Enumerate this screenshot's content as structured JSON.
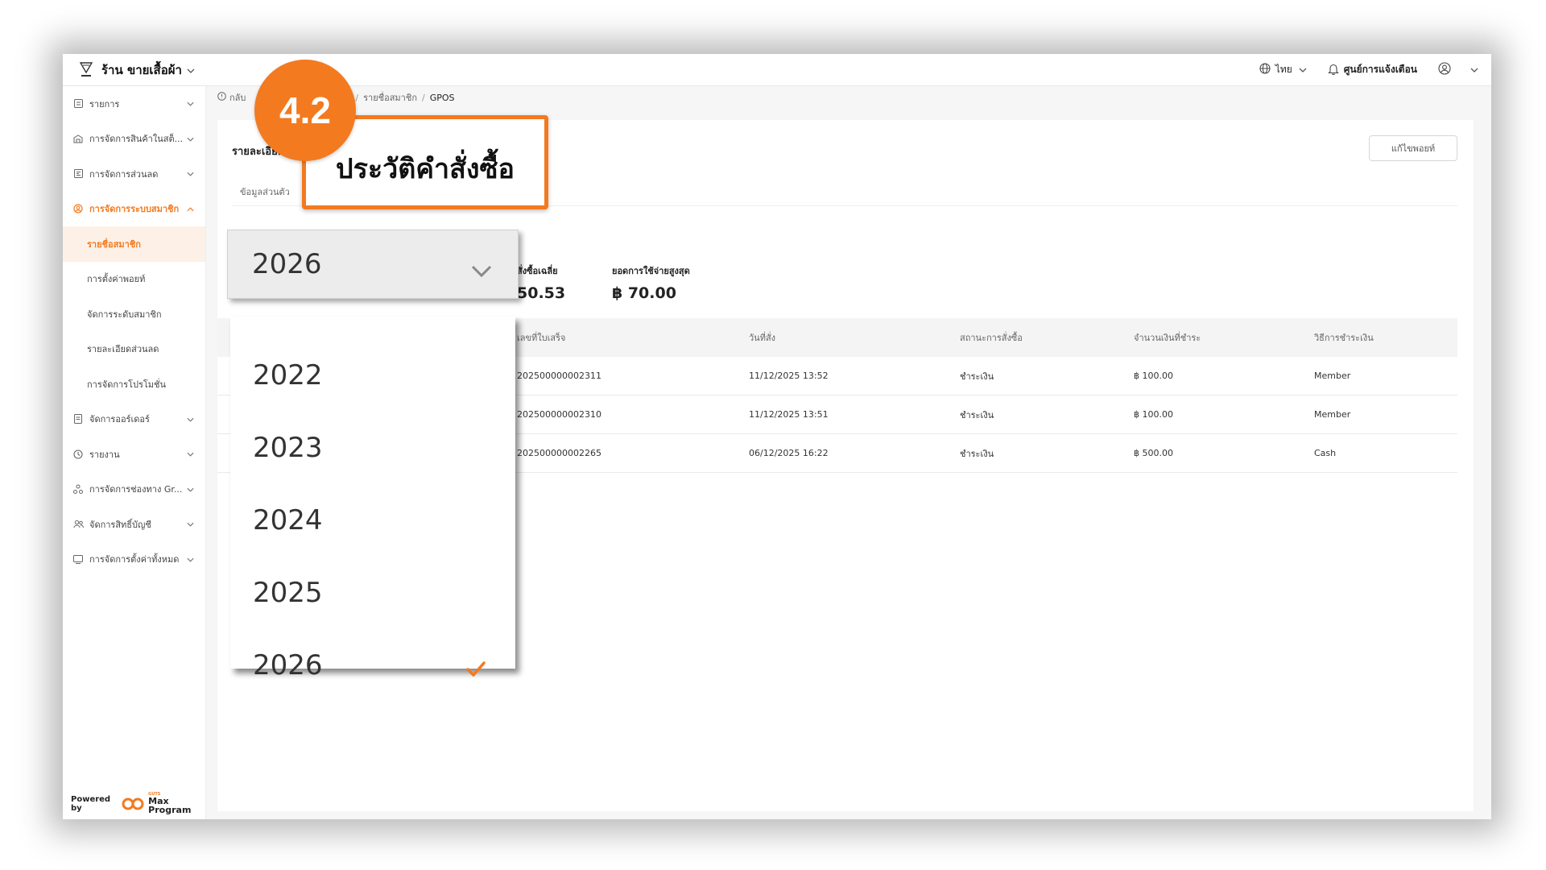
{
  "header": {
    "store_name": "ร้าน ขายเสื้อผ้า",
    "language": "ไทย",
    "notification_center": "ศูนย์การแจ้งเตือน"
  },
  "sidebar": {
    "items": [
      {
        "label": "รายการ",
        "icon": "list-icon"
      },
      {
        "label": "การจัดการสินค้าในสต็...",
        "icon": "warehouse-icon"
      },
      {
        "label": "การจัดการส่วนลด",
        "icon": "discount-icon"
      },
      {
        "label": "การจัดการระบบสมาชิก",
        "icon": "member-icon",
        "active": true
      }
    ],
    "sub_items": [
      {
        "label": "รายชื่อสมาชิก",
        "active": true
      },
      {
        "label": "การตั้งค่าพอยท์"
      },
      {
        "label": "จัดการระดับสมาชิก"
      },
      {
        "label": "รายละเอียดส่วนลด"
      },
      {
        "label": "การจัดการโปรโมชั่น"
      }
    ],
    "items_after": [
      {
        "label": "จัดการออร์เดอร์",
        "icon": "order-icon"
      },
      {
        "label": "รายงาน",
        "icon": "clock-icon"
      },
      {
        "label": "การจัดการช่องทาง Gr...",
        "icon": "channel-icon"
      },
      {
        "label": "จัดการสิทธิ์บัญชี",
        "icon": "users-icon"
      },
      {
        "label": "การจัดการตั้งค่าทั้งหมด",
        "icon": "settings-icon"
      }
    ],
    "powered_by": "Powered by",
    "brand_small": "GUTS",
    "brand_product": "Max Program"
  },
  "breadcrumb": {
    "back": "กลับ",
    "middle": "รายชื่อสมาชิก",
    "current": "GPOS"
  },
  "card": {
    "title": "รายละเอียด",
    "edit_points_button": "แก้ไขพอยท์",
    "tab_personal": "ข้อมูลส่วนตัว",
    "stats": [
      {
        "label": "สั่งซื้อเฉลี่ย",
        "value": "50.53"
      },
      {
        "label": "ยอดการใช้จ่ายสูงสุด",
        "value": "฿ 70.00"
      }
    ]
  },
  "table": {
    "headers": [
      "เลขที่ใบเสร็จ",
      "วันที่สั่ง",
      "สถานะการสั่งซื้อ",
      "จำนวนเงินที่ชำระ",
      "วิธีการชำระเงิน"
    ],
    "rows": [
      [
        "202500000002311",
        "11/12/2025 13:52",
        "ชำระเงิน",
        "฿ 100.00",
        "Member"
      ],
      [
        "202500000002310",
        "11/12/2025 13:51",
        "ชำระเงิน",
        "฿ 100.00",
        "Member"
      ],
      [
        "202500000002265",
        "06/12/2025 16:22",
        "ชำระเงิน",
        "฿ 500.00",
        "Cash"
      ]
    ]
  },
  "year_dropdown": {
    "selected": "2026",
    "options": [
      "2022",
      "2023",
      "2024",
      "2025",
      "2026"
    ]
  },
  "annotation": {
    "step": "4.2",
    "callout_text": "ประวัติคำสั่งซื้อ"
  },
  "colors": {
    "accent": "#f37a1f"
  }
}
